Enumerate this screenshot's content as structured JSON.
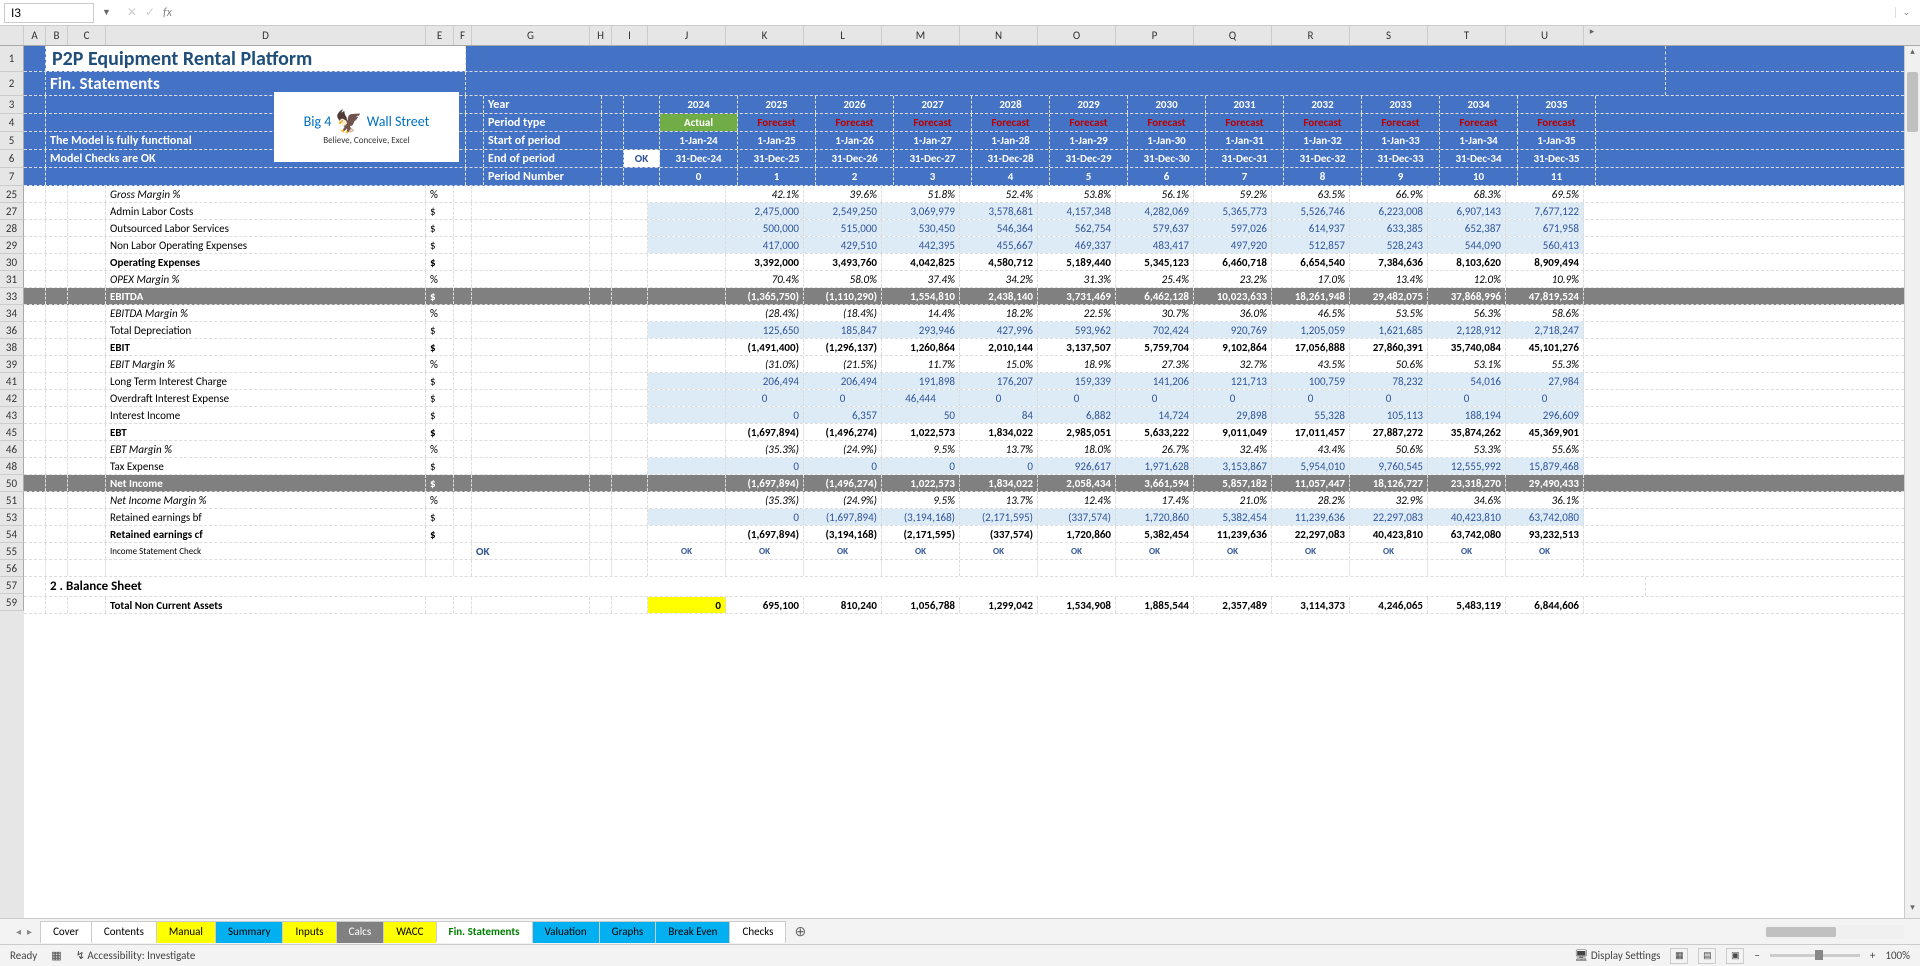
{
  "nameBox": "I3",
  "title1": "P2P Equipment Rental Platform",
  "title2": "Fin. Statements",
  "modelMsg1": "The Model is fully functional",
  "modelMsg2": "Model Checks are OK",
  "okLabel": "OK",
  "hdrLabels": {
    "year": "Year",
    "ptype": "Period type",
    "start": "Start of period",
    "end": "End of period",
    "pnum": "Period Number"
  },
  "years": [
    "2024",
    "2025",
    "2026",
    "2027",
    "2028",
    "2029",
    "2030",
    "2031",
    "2032",
    "2033",
    "2034",
    "2035"
  ],
  "ptypes": [
    "Actual",
    "Forecast",
    "Forecast",
    "Forecast",
    "Forecast",
    "Forecast",
    "Forecast",
    "Forecast",
    "Forecast",
    "Forecast",
    "Forecast",
    "Forecast"
  ],
  "starts": [
    "1-Jan-24",
    "1-Jan-25",
    "1-Jan-26",
    "1-Jan-27",
    "1-Jan-28",
    "1-Jan-29",
    "1-Jan-30",
    "1-Jan-31",
    "1-Jan-32",
    "1-Jan-33",
    "1-Jan-34",
    "1-Jan-35"
  ],
  "ends": [
    "31-Dec-24",
    "31-Dec-25",
    "31-Dec-26",
    "31-Dec-27",
    "31-Dec-28",
    "31-Dec-29",
    "31-Dec-30",
    "31-Dec-31",
    "31-Dec-32",
    "31-Dec-33",
    "31-Dec-34",
    "31-Dec-35"
  ],
  "pnums": [
    "0",
    "1",
    "2",
    "3",
    "4",
    "5",
    "6",
    "7",
    "8",
    "9",
    "10",
    "11"
  ],
  "colLetters": [
    "A",
    "B",
    "C",
    "D",
    "E",
    "F",
    "G",
    "H",
    "I",
    "J",
    "K",
    "L",
    "M",
    "N",
    "O",
    "P",
    "Q",
    "R",
    "S",
    "T",
    "U"
  ],
  "rowNums": [
    "1",
    "2",
    "3",
    "4",
    "5",
    "6",
    "7",
    "25",
    "27",
    "28",
    "29",
    "30",
    "31",
    "33",
    "34",
    "36",
    "38",
    "39",
    "41",
    "42",
    "43",
    "45",
    "46",
    "48",
    "50",
    "51",
    "53",
    "54",
    "55",
    "56",
    "57",
    "59"
  ],
  "rows": [
    {
      "label": "Gross Margin %",
      "unit": "%",
      "italic": true,
      "vals": [
        "",
        "42.1%",
        "39.6%",
        "51.8%",
        "52.4%",
        "53.8%",
        "56.1%",
        "59.2%",
        "63.5%",
        "66.9%",
        "68.3%",
        "69.5%"
      ]
    },
    {
      "label": "Admin Labor Costs",
      "unit": "$",
      "blue": true,
      "bg": true,
      "vals": [
        "",
        "2,475,000",
        "2,549,250",
        "3,069,979",
        "3,578,681",
        "4,157,348",
        "4,282,069",
        "5,365,773",
        "5,526,746",
        "6,223,008",
        "6,907,143",
        "7,677,122"
      ]
    },
    {
      "label": "Outsourced Labor Services",
      "unit": "$",
      "blue": true,
      "bg": true,
      "vals": [
        "",
        "500,000",
        "515,000",
        "530,450",
        "546,364",
        "562,754",
        "579,637",
        "597,026",
        "614,937",
        "633,385",
        "652,387",
        "671,958"
      ]
    },
    {
      "label": "Non Labor Operating Expenses",
      "unit": "$",
      "blue": true,
      "bg": true,
      "vals": [
        "",
        "417,000",
        "429,510",
        "442,395",
        "455,667",
        "469,337",
        "483,417",
        "497,920",
        "512,857",
        "528,243",
        "544,090",
        "560,413"
      ]
    },
    {
      "label": "Operating Expenses",
      "unit": "$",
      "bold": true,
      "vals": [
        "",
        "3,392,000",
        "3,493,760",
        "4,042,825",
        "4,580,712",
        "5,189,440",
        "5,345,123",
        "6,460,718",
        "6,654,540",
        "7,384,636",
        "8,103,620",
        "8,909,494"
      ]
    },
    {
      "label": "OPEX Margin %",
      "unit": "%",
      "italic": true,
      "vals": [
        "",
        "70.4%",
        "58.0%",
        "37.4%",
        "34.2%",
        "31.3%",
        "25.4%",
        "23.2%",
        "17.0%",
        "13.4%",
        "12.0%",
        "10.9%"
      ]
    },
    {
      "label": "EBITDA",
      "unit": "$",
      "gray": true,
      "vals": [
        "",
        "(1,365,750)",
        "(1,110,290)",
        "1,554,810",
        "2,438,140",
        "3,731,469",
        "6,462,128",
        "10,023,633",
        "18,261,948",
        "29,482,075",
        "37,868,996",
        "47,819,524"
      ]
    },
    {
      "label": "EBITDA Margin %",
      "unit": "%",
      "italic": true,
      "vals": [
        "",
        "(28.4%)",
        "(18.4%)",
        "14.4%",
        "18.2%",
        "22.5%",
        "30.7%",
        "36.0%",
        "46.5%",
        "53.5%",
        "56.3%",
        "58.6%"
      ]
    },
    {
      "label": "Total Depreciation",
      "unit": "$",
      "blue": true,
      "bg": true,
      "vals": [
        "",
        "125,650",
        "185,847",
        "293,946",
        "427,996",
        "593,962",
        "702,424",
        "920,769",
        "1,205,059",
        "1,621,685",
        "2,128,912",
        "2,718,247"
      ]
    },
    {
      "label": "EBIT",
      "unit": "$",
      "bold": true,
      "vals": [
        "",
        "(1,491,400)",
        "(1,296,137)",
        "1,260,864",
        "2,010,144",
        "3,137,507",
        "5,759,704",
        "9,102,864",
        "17,056,888",
        "27,860,391",
        "35,740,084",
        "45,101,276"
      ]
    },
    {
      "label": "EBIT Margin %",
      "unit": "%",
      "italic": true,
      "vals": [
        "",
        "(31.0%)",
        "(21.5%)",
        "11.7%",
        "15.0%",
        "18.9%",
        "27.3%",
        "32.7%",
        "43.5%",
        "50.6%",
        "53.1%",
        "55.3%"
      ]
    },
    {
      "label": "Long Term Interest Charge",
      "unit": "$",
      "blue": true,
      "bg": true,
      "vals": [
        "",
        "206,494",
        "206,494",
        "191,898",
        "176,207",
        "159,339",
        "141,206",
        "121,713",
        "100,759",
        "78,232",
        "54,016",
        "27,984"
      ]
    },
    {
      "label": "Overdraft Interest Expense",
      "unit": "$",
      "blue": true,
      "bg": true,
      "center": true,
      "vals": [
        "",
        "0",
        "0",
        "46,444",
        "0",
        "0",
        "0",
        "0",
        "0",
        "0",
        "0",
        "0"
      ]
    },
    {
      "label": "Interest Income",
      "unit": "$",
      "blue": true,
      "bg": true,
      "vals": [
        "",
        "0",
        "6,357",
        "50",
        "84",
        "6,882",
        "14,724",
        "29,898",
        "55,328",
        "105,113",
        "188,194",
        "296,609"
      ]
    },
    {
      "label": "EBT",
      "unit": "$",
      "bold": true,
      "vals": [
        "",
        "(1,697,894)",
        "(1,496,274)",
        "1,022,573",
        "1,834,022",
        "2,985,051",
        "5,633,222",
        "9,011,049",
        "17,011,457",
        "27,887,272",
        "35,874,262",
        "45,369,901"
      ]
    },
    {
      "label": "EBT Margin %",
      "unit": "%",
      "italic": true,
      "vals": [
        "",
        "(35.3%)",
        "(24.9%)",
        "9.5%",
        "13.7%",
        "18.0%",
        "26.7%",
        "32.4%",
        "43.4%",
        "50.6%",
        "53.3%",
        "55.6%"
      ]
    },
    {
      "label": "Tax Expense",
      "unit": "$",
      "blue": true,
      "bg": true,
      "vals": [
        "",
        "0",
        "0",
        "0",
        "0",
        "926,617",
        "1,971,628",
        "3,153,867",
        "5,954,010",
        "9,760,545",
        "12,555,992",
        "15,879,468"
      ]
    },
    {
      "label": "Net Income",
      "unit": "$",
      "gray": true,
      "vals": [
        "",
        "(1,697,894)",
        "(1,496,274)",
        "1,022,573",
        "1,834,022",
        "2,058,434",
        "3,661,594",
        "5,857,182",
        "11,057,447",
        "18,126,727",
        "23,318,270",
        "29,490,433"
      ]
    },
    {
      "label": "Net Income Margin %",
      "unit": "%",
      "italic": true,
      "vals": [
        "",
        "(35.3%)",
        "(24.9%)",
        "9.5%",
        "13.7%",
        "12.4%",
        "17.4%",
        "21.0%",
        "28.2%",
        "32.9%",
        "34.6%",
        "36.1%"
      ]
    },
    {
      "label": "Retained earnings bf",
      "unit": "$",
      "blue": true,
      "bg": true,
      "vals": [
        "",
        "0",
        "(1,697,894)",
        "(3,194,168)",
        "(2,171,595)",
        "(337,574)",
        "1,720,860",
        "5,382,454",
        "11,239,636",
        "22,297,083",
        "40,423,810",
        "63,742,080"
      ]
    },
    {
      "label": "Retained earnings cf",
      "unit": "$",
      "bold": true,
      "vals": [
        "",
        "(1,697,894)",
        "(3,194,168)",
        "(2,171,595)",
        "(337,574)",
        "1,720,860",
        "5,382,454",
        "11,239,636",
        "22,297,083",
        "40,423,810",
        "63,742,080",
        "93,232,513"
      ]
    },
    {
      "label": "Income Statement Check",
      "unit": "",
      "small": true,
      "okrow": true,
      "vals": [
        "OK",
        "OK",
        "OK",
        "OK",
        "OK",
        "OK",
        "OK",
        "OK",
        "OK",
        "OK",
        "OK",
        "OK"
      ]
    },
    {
      "label": "",
      "unit": "",
      "blank": true,
      "vals": [
        "",
        "",
        "",
        "",
        "",
        "",
        "",
        "",
        "",
        "",
        "",
        ""
      ]
    },
    {
      "label": "2 . Balance Sheet",
      "unit": "",
      "section": true,
      "vals": [
        "",
        "",
        "",
        "",
        "",
        "",
        "",
        "",
        "",
        "",
        "",
        ""
      ]
    },
    {
      "label": "Total Non Current Assets",
      "unit": "",
      "bold": true,
      "tnca": true,
      "vals": [
        "0",
        "695,100",
        "810,240",
        "1,056,788",
        "1,299,042",
        "1,534,908",
        "1,885,544",
        "2,357,489",
        "3,114,373",
        "4,246,065",
        "5,483,119",
        "6,844,606"
      ]
    }
  ],
  "tabs": [
    {
      "name": "Cover",
      "cls": ""
    },
    {
      "name": "Contents",
      "cls": ""
    },
    {
      "name": "Manual",
      "cls": "yellow"
    },
    {
      "name": "Summary",
      "cls": "blue"
    },
    {
      "name": "Inputs",
      "cls": "yellow"
    },
    {
      "name": "Calcs",
      "cls": "gray"
    },
    {
      "name": "WACC",
      "cls": "yellow"
    },
    {
      "name": "Fin. Statements",
      "cls": "active"
    },
    {
      "name": "Valuation",
      "cls": "blue"
    },
    {
      "name": "Graphs",
      "cls": "blue"
    },
    {
      "name": "Break Even",
      "cls": "blue"
    },
    {
      "name": "Checks",
      "cls": ""
    }
  ],
  "status": {
    "ready": "Ready",
    "access": "Accessibility: Investigate",
    "display": "Display Settings",
    "zoom": "100%"
  },
  "logo": {
    "l1a": "Big 4",
    "l1b": "Wall Street",
    "l2": "Believe, Conceive, Excel"
  }
}
